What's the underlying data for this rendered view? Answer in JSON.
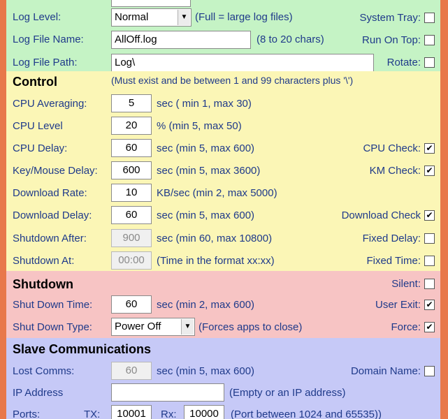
{
  "log": {
    "level_label": "Log Level:",
    "level_value": "Normal",
    "level_note": "(Full = large log files)",
    "file_name_label": "Log File Name:",
    "file_name_value": "AllOff.log",
    "file_name_note": "(8 to 20 chars)",
    "file_path_label": "Log File Path:",
    "file_path_value": "Log\\",
    "system_tray_label": "System Tray:",
    "run_on_top_label": "Run On Top:",
    "rotate_label": "Rotate:"
  },
  "control": {
    "heading": "Control",
    "path_note": "(Must exist and be between 1 and 99 characters plus '\\')",
    "cpu_averaging": {
      "label": "CPU Averaging:",
      "value": "5",
      "note": "sec ( min 1, max 30)"
    },
    "cpu_level": {
      "label": "CPU Level",
      "value": "20",
      "note": "% (min 5, max 50)"
    },
    "cpu_delay": {
      "label": "CPU Delay:",
      "value": "60",
      "note": "sec (min 5, max 600)"
    },
    "key_mouse_delay": {
      "label": "Key/Mouse Delay:",
      "value": "600",
      "note": "sec (min 5, max 3600)"
    },
    "download_rate": {
      "label": "Download Rate:",
      "value": "10",
      "note": "KB/sec (min 2, max 5000)"
    },
    "download_delay": {
      "label": "Download Delay:",
      "value": "60",
      "note": "sec (min 5, max 600)"
    },
    "shutdown_after": {
      "label": "Shutdown After:",
      "value": "900",
      "note": "sec (min 60, max 10800)"
    },
    "shutdown_at": {
      "label": "Shutdown At:",
      "value": "00:00",
      "note": "(Time in the format xx:xx)"
    },
    "cpu_check_label": "CPU Check:",
    "km_check_label": "KM Check:",
    "download_check_label": "Download Check",
    "fixed_delay_label": "Fixed Delay:",
    "fixed_time_label": "Fixed Time:"
  },
  "shutdown": {
    "heading": "Shutdown",
    "time_label": "Shut Down Time:",
    "time_value": "60",
    "time_note": "sec (min 2, max 600)",
    "type_label": "Shut Down Type:",
    "type_value": "Power Off",
    "type_note": "(Forces apps to close)",
    "silent_label": "Silent:",
    "user_exit_label": "User Exit:",
    "force_label": "Force:"
  },
  "slave": {
    "heading": "Slave Communications",
    "lost_comms_label": "Lost Comms:",
    "lost_comms_value": "60",
    "lost_comms_note": "sec (min 5, max 600)",
    "domain_name_label": "Domain Name:",
    "ip_label": "IP Address",
    "ip_value": "",
    "ip_note": "(Empty or an IP address)",
    "ports_label": "Ports:",
    "tx_label": "TX:",
    "tx_value": "10001",
    "rx_label": "Rx:",
    "rx_value": "10000",
    "ports_note": "(Port between 1024 and 65535))"
  },
  "checkboxes": {
    "system_tray": false,
    "run_on_top": false,
    "rotate": false,
    "cpu_check": true,
    "km_check": true,
    "download_check": true,
    "fixed_delay": false,
    "fixed_time": false,
    "silent": false,
    "user_exit": true,
    "force": true,
    "domain_name": false
  },
  "colors": {
    "window_bg": "#e8784a",
    "log_section": "#c5f3c5",
    "control_section": "#fbf6b6",
    "shutdown_section": "#f7c4c4",
    "slave_section": "#c6c9f7",
    "label_text": "#1f3a8a"
  },
  "icons": {
    "dropdown": "chevron-down-icon",
    "checkbox_checked": "check-icon"
  }
}
